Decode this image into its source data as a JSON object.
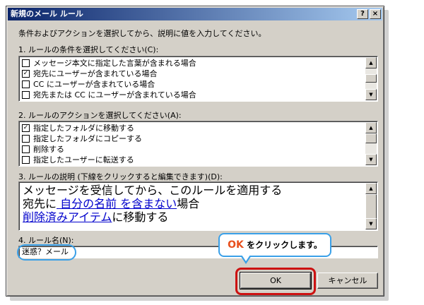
{
  "window": {
    "title": "新規のメール ルール",
    "help_button": "?",
    "close_button": "×"
  },
  "instruction": "条件およびアクションを選択してから、説明に値を入力してください。",
  "conditions": {
    "label": "1. ルールの条件を選択してください(C):",
    "items": [
      {
        "label": "メッセージ本文に指定した言葉が含まれる場合",
        "checked": false
      },
      {
        "label": "宛先にユーザーが含まれている場合",
        "checked": true
      },
      {
        "label": "CC にユーザーが含まれている場合",
        "checked": false
      },
      {
        "label": "宛先または CC にユーザーが含まれている場合",
        "checked": false
      }
    ]
  },
  "actions": {
    "label": "2. ルールのアクションを選択してください(A):",
    "items": [
      {
        "label": "指定したフォルダに移動する",
        "checked": true
      },
      {
        "label": "指定したフォルダにコピーする",
        "checked": false
      },
      {
        "label": "削除する",
        "checked": false
      },
      {
        "label": "指定したユーザーに転送する",
        "checked": false
      }
    ]
  },
  "description": {
    "label": "3. ルールの説明 (下線をクリックすると編集できます)(D):",
    "line1": "メッセージを受信してから、このルールを適用する",
    "line2_prefix": "宛先に",
    "line2_link": " 自分の名前 を含まない",
    "line2_suffix": "場合",
    "line3_link": "削除済みアイテム",
    "line3_suffix": "に移動する"
  },
  "rule_name": {
    "label": "4. ルール名(N):",
    "value": "迷惑？メール"
  },
  "buttons": {
    "ok": "OK",
    "cancel": "キャンセル"
  },
  "callout": {
    "ok_word": "OK",
    "text": "をクリックします。"
  },
  "scroll_arrows": {
    "up": "▲",
    "down": "▼"
  },
  "check_mark": "✓",
  "colors": {
    "callout_border": "#3aa0e8",
    "ok_highlight": "#cc1111",
    "ok_word": "#e8501e",
    "link": "#0000cc"
  }
}
